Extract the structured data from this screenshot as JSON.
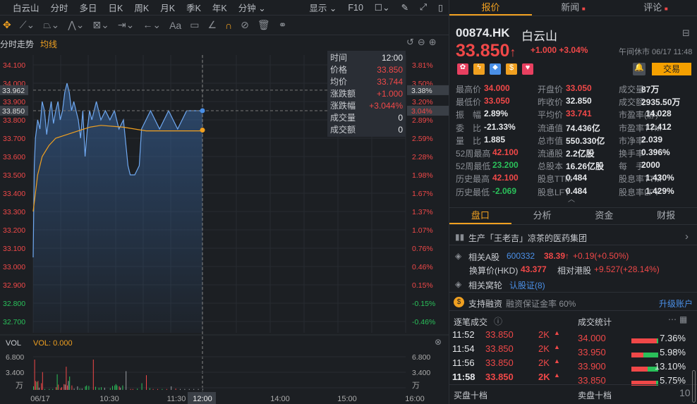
{
  "toolbar": {
    "name_tab": "白云山",
    "tabs": [
      "分时",
      "多日",
      "日K",
      "周K",
      "月K",
      "季K",
      "年K",
      "分钟"
    ],
    "display": "显示",
    "f10": "F10"
  },
  "chart_tabs": {
    "trend": "分时走势",
    "avg": "均线"
  },
  "chart_data": {
    "type": "line",
    "y_ticks": [
      "34.100",
      "34.000",
      "33.900",
      "33.800",
      "33.700",
      "33.600",
      "33.500",
      "33.400",
      "33.300",
      "33.200",
      "33.100",
      "33.000",
      "32.900",
      "32.800",
      "32.700"
    ],
    "pct_ticks": [
      "3.81%",
      "3.50%",
      "3.20%",
      "2.89%",
      "2.59%",
      "2.28%",
      "1.98%",
      "1.67%",
      "1.37%",
      "1.07%",
      "0.76%",
      "0.46%",
      "0.15%",
      "-0.15%",
      "-0.46%"
    ],
    "ylim": [
      32.65,
      34.15
    ],
    "prev_close": 32.85,
    "crosshair_price": "33.962",
    "crosshair_pct": "3.38%",
    "current_price_label": "33.850",
    "current_pct_label": "3.04%",
    "x_ticks": [
      "06/17",
      "10:30",
      "11:30",
      "12:00",
      "14:00",
      "15:00",
      "16:00"
    ],
    "price": [
      [
        0,
        33.05
      ],
      [
        1,
        33.55
      ],
      [
        2,
        33.7
      ],
      [
        4,
        33.8
      ],
      [
        6,
        33.75
      ],
      [
        8,
        33.9
      ],
      [
        10,
        33.85
      ],
      [
        12,
        33.72
      ],
      [
        14,
        33.82
      ],
      [
        16,
        33.9
      ],
      [
        18,
        33.78
      ],
      [
        20,
        33.85
      ],
      [
        22,
        33.9
      ],
      [
        24,
        33.8
      ],
      [
        26,
        33.85
      ],
      [
        28,
        33.95
      ],
      [
        30,
        34.0
      ],
      [
        32,
        33.95
      ],
      [
        34,
        33.85
      ],
      [
        36,
        33.9
      ],
      [
        38,
        33.85
      ],
      [
        40,
        33.8
      ],
      [
        42,
        33.7
      ],
      [
        44,
        33.85
      ],
      [
        46,
        33.6
      ],
      [
        48,
        33.75
      ],
      [
        50,
        33.85
      ],
      [
        52,
        33.8
      ],
      [
        56,
        33.9
      ],
      [
        60,
        33.8
      ],
      [
        64,
        33.85
      ],
      [
        68,
        33.8
      ],
      [
        72,
        33.85
      ],
      [
        76,
        33.75
      ],
      [
        80,
        33.8
      ],
      [
        84,
        33.55
      ],
      [
        86,
        33.5
      ],
      [
        90,
        33.5
      ],
      [
        94,
        33.55
      ],
      [
        96,
        33.75
      ],
      [
        100,
        33.8
      ],
      [
        104,
        33.85
      ],
      [
        108,
        33.8
      ],
      [
        112,
        33.75
      ],
      [
        116,
        33.8
      ],
      [
        120,
        33.85
      ],
      [
        124,
        33.8
      ],
      [
        128,
        33.75
      ],
      [
        132,
        33.8
      ],
      [
        136,
        33.85
      ],
      [
        140,
        33.85
      ],
      [
        144,
        33.85
      ],
      [
        150,
        33.85
      ]
    ],
    "avg": [
      [
        0,
        33.3
      ],
      [
        4,
        33.5
      ],
      [
        8,
        33.6
      ],
      [
        14,
        33.66
      ],
      [
        20,
        33.7
      ],
      [
        30,
        33.72
      ],
      [
        40,
        33.74
      ],
      [
        50,
        33.76
      ],
      [
        60,
        33.77
      ],
      [
        80,
        33.76
      ],
      [
        100,
        33.74
      ],
      [
        120,
        33.74
      ],
      [
        150,
        33.74
      ]
    ],
    "volume": {
      "label": "VOL",
      "value_label": "VOL: 0.000",
      "ticks": [
        "6.800",
        "3.400"
      ],
      "unit": "万",
      "max": 7.0,
      "bars": [
        [
          0,
          0.8,
          "g"
        ],
        [
          1,
          6.8,
          "r"
        ],
        [
          2,
          2.0,
          "r"
        ],
        [
          3,
          1.8,
          "g"
        ],
        [
          4,
          2.0,
          "r"
        ],
        [
          5,
          0.5,
          "gr"
        ],
        [
          7,
          1.5,
          "r"
        ],
        [
          8,
          4.0,
          "r"
        ],
        [
          10,
          0.2,
          "g"
        ],
        [
          14,
          0.2,
          "g"
        ],
        [
          17,
          0.2,
          "g"
        ],
        [
          20,
          0.6,
          "r"
        ],
        [
          21,
          3.5,
          "g"
        ],
        [
          22,
          1.2,
          "r"
        ],
        [
          24,
          0.4,
          "r"
        ],
        [
          25,
          0.6,
          "r"
        ],
        [
          27,
          1.3,
          "r"
        ],
        [
          28,
          1.2,
          "gr"
        ],
        [
          29,
          5.2,
          "r"
        ],
        [
          30,
          1.0,
          "r"
        ],
        [
          31,
          2.0,
          "gr"
        ],
        [
          32,
          3.0,
          "g"
        ],
        [
          34,
          1.0,
          "r"
        ],
        [
          36,
          0.3,
          "gr"
        ],
        [
          39,
          0.8,
          "gr"
        ],
        [
          41,
          0.3,
          "g"
        ],
        [
          43,
          0.3,
          "gr"
        ],
        [
          46,
          0.8,
          "g"
        ],
        [
          47,
          1.0,
          "g"
        ],
        [
          49,
          0.9,
          "g"
        ],
        [
          53,
          6.8,
          "r"
        ],
        [
          55,
          0.7,
          "g"
        ],
        [
          58,
          0.5,
          "g"
        ],
        [
          60,
          0.6,
          "g"
        ],
        [
          63,
          0.5,
          "gr"
        ],
        [
          68,
          0.4,
          "g"
        ],
        [
          70,
          0.9,
          "g"
        ],
        [
          72,
          1.0,
          "g"
        ],
        [
          73,
          1.3,
          "g"
        ],
        [
          74,
          1.0,
          "g"
        ],
        [
          76,
          0.8,
          "r"
        ],
        [
          77,
          0.5,
          "gr"
        ],
        [
          79,
          1.0,
          "g"
        ],
        [
          82,
          4.2,
          "gr"
        ],
        [
          86,
          0.2,
          "r"
        ],
        [
          88,
          0.2,
          "r"
        ],
        [
          92,
          0.3,
          "g"
        ],
        [
          96,
          1.5,
          "g"
        ],
        [
          100,
          3.3,
          "r"
        ],
        [
          103,
          0.4,
          "g"
        ],
        [
          106,
          0.2,
          "r"
        ],
        [
          110,
          0.2,
          "r"
        ],
        [
          114,
          0.2,
          "g"
        ],
        [
          118,
          0.2,
          "r"
        ],
        [
          122,
          0.8,
          "gr"
        ],
        [
          126,
          0.3,
          "r"
        ],
        [
          130,
          0.2,
          "gr"
        ],
        [
          134,
          0.2,
          "gr"
        ],
        [
          138,
          0.2,
          "gr"
        ],
        [
          142,
          0.2,
          "gr"
        ],
        [
          146,
          0.2,
          "gr"
        ],
        [
          150,
          0.2,
          "gr"
        ]
      ]
    }
  },
  "tooltip": [
    [
      "时间",
      "12:00"
    ],
    [
      "价格",
      "33.850"
    ],
    [
      "均价",
      "33.744"
    ],
    [
      "涨跌额",
      "+1.000"
    ],
    [
      "涨跌幅",
      "+3.044%"
    ],
    [
      "成交量",
      "0"
    ],
    [
      "成交额",
      "0"
    ]
  ],
  "right": {
    "tabs": [
      "报价",
      "新闻",
      "评论"
    ],
    "code": "00874.HK",
    "name": "白云山",
    "price": "33.850",
    "arrow": "↑",
    "change": "+1.000",
    "change_pct": "+3.04%",
    "status": "午间休市 06/17 11:48",
    "trade_btn": "交易",
    "stats": [
      [
        [
          "最高价",
          "34.000",
          "red"
        ],
        [
          "开盘价",
          "33.050",
          "red"
        ],
        [
          "成交量",
          "87万",
          "white"
        ]
      ],
      [
        [
          "最低价",
          "33.050",
          "red"
        ],
        [
          "昨收价",
          "32.850",
          "white"
        ],
        [
          "成交额",
          "2935.50万",
          "white"
        ]
      ],
      [
        [
          "振　幅",
          "2.89%",
          "white"
        ],
        [
          "平均价",
          "33.741",
          "red"
        ],
        [
          "市盈率(静)",
          "14.028",
          "white"
        ]
      ],
      [
        [
          "委　比",
          "-21.33%",
          "white"
        ],
        [
          "流通值",
          "74.436亿",
          "white"
        ],
        [
          "市盈率TTM",
          "12.412",
          "white"
        ]
      ],
      [
        [
          "量　比",
          "1.885",
          "white"
        ],
        [
          "总市值",
          "550.330亿",
          "white"
        ],
        [
          "市净率",
          "2.039",
          "white"
        ]
      ],
      [
        [
          "52周最高",
          "42.100",
          "red"
        ],
        [
          "流通股",
          "2.2亿股",
          "white"
        ],
        [
          "换手率",
          "0.396%",
          "white"
        ]
      ],
      [
        [
          "52周最低",
          "23.200",
          "green"
        ],
        [
          "总股本",
          "16.26亿股",
          "white"
        ],
        [
          "每　手",
          "2000",
          "white"
        ]
      ],
      [
        [
          "历史最高",
          "42.100",
          "red"
        ],
        [
          "股息TTM",
          "0.484",
          "white"
        ],
        [
          "股息率TTM",
          "1.430%",
          "white"
        ]
      ],
      [
        [
          "历史最低",
          "-2.069",
          "green"
        ],
        [
          "股息LFY",
          "0.484",
          "white"
        ],
        [
          "股息率LFY",
          "1.429%",
          "white"
        ]
      ]
    ],
    "subtabs": [
      "盘口",
      "分析",
      "资金",
      "财报"
    ],
    "desc": "生产「王老吉」凉茶的医药集团",
    "a_share_label": "相关A股",
    "a_code": "600332",
    "a_price": "38.39",
    "a_arrow": "↑",
    "a_change": "+0.19(+0.50%)",
    "hkd_label": "换算价(HKD)",
    "hkd_value": "43.377",
    "premium_label": "相对港股",
    "premium_value": "+9.527(+28.14%)",
    "warrant_label": "相关窝轮",
    "warrant_link": "认股证(8)",
    "margin_label": "支持融资",
    "margin_rate": "融资保证金率 60%",
    "upgrade": "升级账户",
    "ticks_title": "逐笔成交",
    "ticks": [
      [
        "11:52",
        "33.850",
        "2K"
      ],
      [
        "11:54",
        "33.850",
        "2K"
      ],
      [
        "11:56",
        "33.850",
        "2K"
      ],
      [
        "11:58",
        "33.850",
        "2K"
      ]
    ],
    "stats_title": "成交统计",
    "volstats": [
      [
        "34.000",
        "7.36%",
        0.95
      ],
      [
        "33.950",
        "5.98%",
        0.45
      ],
      [
        "33.900",
        "13.10%",
        0.6
      ],
      [
        "33.850",
        "5.75%",
        0.93
      ]
    ],
    "bid_title": "买盘十档",
    "ask_title": "卖盘十档",
    "depth": "10"
  }
}
